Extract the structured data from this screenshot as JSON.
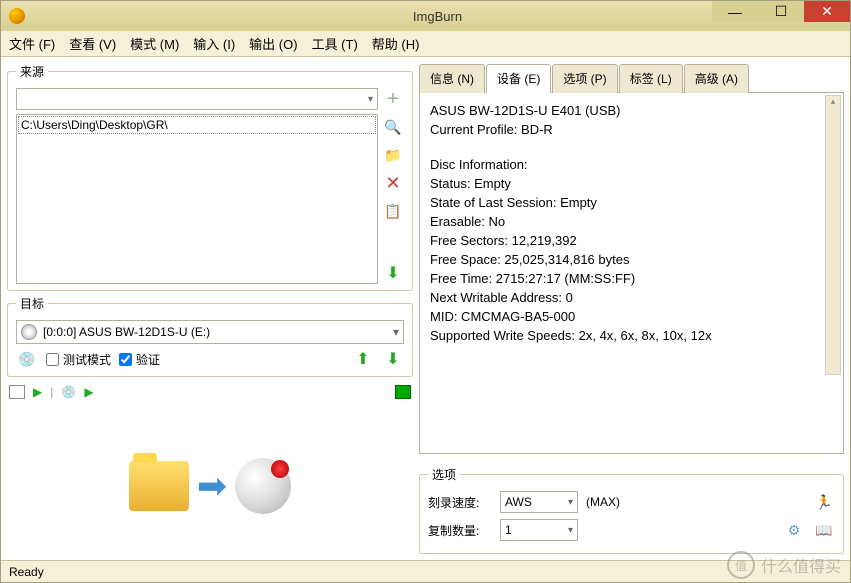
{
  "title": "ImgBurn",
  "menu": [
    "文件 (F)",
    "查看 (V)",
    "模式 (M)",
    "输入 (I)",
    "输出 (O)",
    "工具 (T)",
    "帮助 (H)"
  ],
  "source": {
    "legend": "来源",
    "items": [
      "C:\\Users\\Ding\\Desktop\\GR\\"
    ],
    "icons": [
      "plus-icon",
      "search-icon",
      "folder-icon",
      "delete-icon",
      "clipboard-icon",
      "go-icon"
    ]
  },
  "destination": {
    "legend": "目标",
    "device": "[0:0:0] ASUS BW-12D1S-U (E:)",
    "test_mode": "测试模式",
    "test_checked": false,
    "verify": "验证",
    "verify_checked": true
  },
  "tabs": {
    "items": [
      {
        "label": "信息 (N)"
      },
      {
        "label": "设备 (E)"
      },
      {
        "label": "选项 (P)"
      },
      {
        "label": "标签 (L)"
      },
      {
        "label": "高级 (A)"
      }
    ],
    "active": 1
  },
  "device_info": [
    "ASUS BW-12D1S-U E401 (USB)",
    "Current Profile: BD-R",
    "",
    "Disc Information:",
    "Status: Empty",
    "State of Last Session: Empty",
    "Erasable: No",
    "Free Sectors: 12,219,392",
    "Free Space: 25,025,314,816 bytes",
    "Free Time: 2715:27:17 (MM:SS:FF)",
    "Next Writable Address: 0",
    "MID: CMCMAG-BA5-000",
    "Supported Write Speeds: 2x, 4x, 6x, 8x, 10x, 12x"
  ],
  "options": {
    "legend": "选项",
    "speed_label": "刻录速度:",
    "speed_value": "AWS",
    "speed_max": "(MAX)",
    "copies_label": "复制数量:",
    "copies_value": "1"
  },
  "status": "Ready",
  "watermark": "什么值得买"
}
